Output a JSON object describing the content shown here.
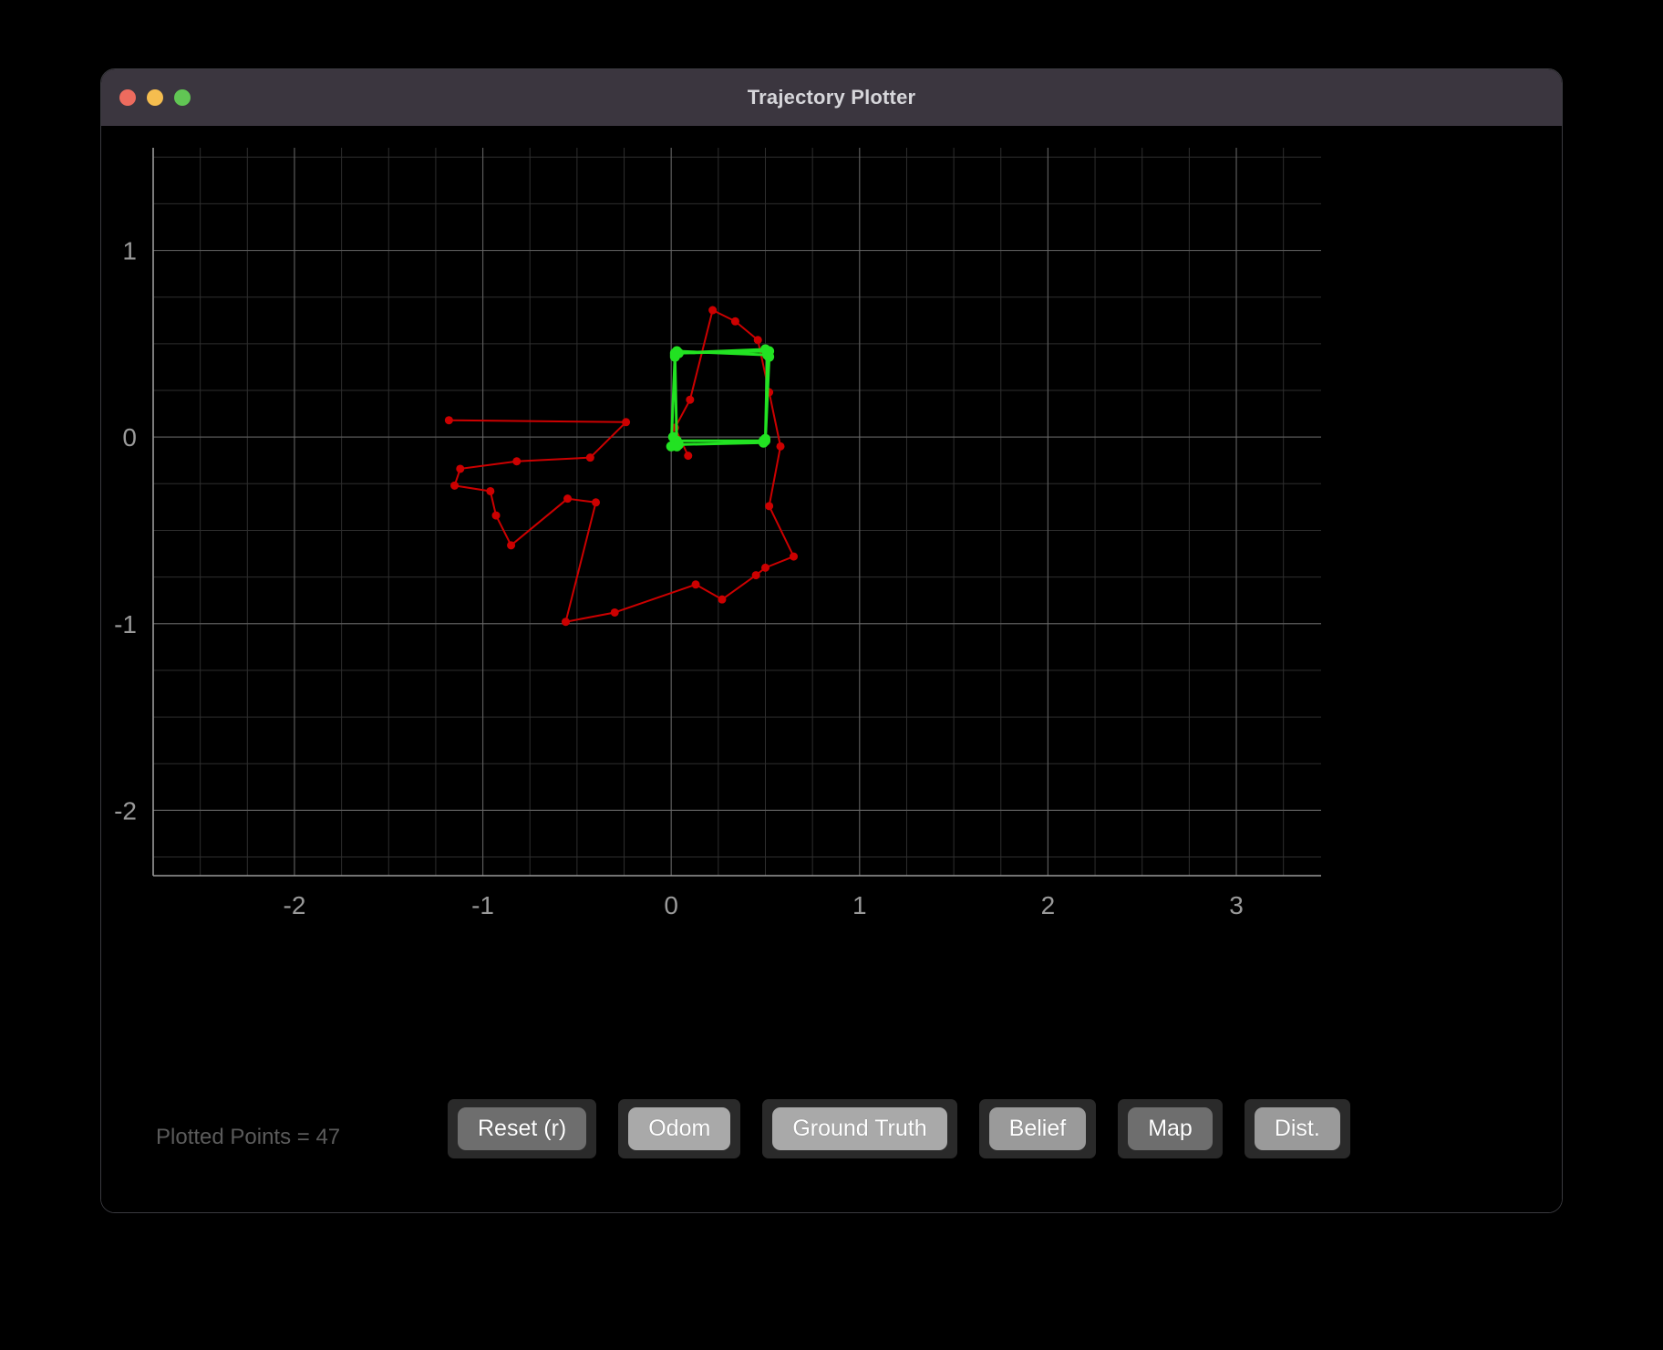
{
  "window": {
    "title": "Trajectory Plotter",
    "traffic_lights": [
      {
        "name": "close",
        "color": "#ED6B5E"
      },
      {
        "name": "minimize",
        "color": "#F5BD4F"
      },
      {
        "name": "zoom",
        "color": "#61C554"
      }
    ]
  },
  "status": {
    "label": "Plotted Points = 47"
  },
  "buttons": [
    {
      "name": "reset",
      "label": "Reset (r)",
      "shade": "shade-dark"
    },
    {
      "name": "odom",
      "label": "Odom",
      "shade": "shade-light"
    },
    {
      "name": "ground-truth",
      "label": "Ground Truth",
      "shade": "shade-light"
    },
    {
      "name": "belief",
      "label": "Belief",
      "shade": "shade-mid"
    },
    {
      "name": "map",
      "label": "Map",
      "shade": "shade-dark"
    },
    {
      "name": "dist",
      "label": "Dist.",
      "shade": "shade-mid"
    }
  ],
  "chart_data": {
    "type": "line",
    "title": "",
    "xlabel": "",
    "ylabel": "",
    "xlim": [
      -2.75,
      3.45
    ],
    "ylim": [
      -2.35,
      1.55
    ],
    "grid": true,
    "background": "#000000",
    "grid_color": "#6b6b6b",
    "minor_grid_color": "#2e2e2e",
    "axis_label_color": "#9a9a9a",
    "legend_position": "none",
    "xticks": [
      -2,
      -1,
      0,
      1,
      2,
      3
    ],
    "xtick_labels": [
      "-2",
      "-1",
      "0",
      "1",
      "2",
      "3"
    ],
    "yticks": [
      1,
      0,
      -1,
      -2
    ],
    "ytick_labels": [
      "1",
      "0",
      "-1",
      "-2"
    ],
    "x_minor_step": 0.25,
    "y_minor_step": 0.25,
    "series": [
      {
        "name": "Odometry",
        "color": "#CC0000",
        "marker": "o",
        "marker_size": 9,
        "line_width": 2,
        "points": [
          [
            -1.18,
            0.09
          ],
          [
            -0.24,
            0.08
          ],
          [
            -0.43,
            -0.11
          ],
          [
            -0.82,
            -0.13
          ],
          [
            -1.12,
            -0.17
          ],
          [
            -1.15,
            -0.26
          ],
          [
            -0.96,
            -0.29
          ],
          [
            -0.93,
            -0.42
          ],
          [
            -0.85,
            -0.58
          ],
          [
            -0.55,
            -0.33
          ],
          [
            -0.4,
            -0.35
          ],
          [
            -0.56,
            -0.99
          ],
          [
            -0.3,
            -0.94
          ],
          [
            0.13,
            -0.79
          ],
          [
            0.27,
            -0.87
          ],
          [
            0.45,
            -0.74
          ],
          [
            0.5,
            -0.7
          ],
          [
            0.65,
            -0.64
          ],
          [
            0.52,
            -0.37
          ],
          [
            0.58,
            -0.05
          ],
          [
            0.52,
            0.24
          ],
          [
            0.46,
            0.52
          ],
          [
            0.34,
            0.62
          ],
          [
            0.22,
            0.68
          ],
          [
            0.1,
            0.2
          ],
          [
            0.02,
            0.05
          ],
          [
            0.09,
            -0.1
          ]
        ]
      },
      {
        "name": "Ground Truth",
        "color": "#22E222",
        "marker": "o",
        "marker_size": 11,
        "line_width": 3,
        "points": [
          [
            0.02,
            0.45
          ],
          [
            0.5,
            0.47
          ],
          [
            0.51,
            0.45
          ],
          [
            0.5,
            -0.01
          ],
          [
            0.49,
            -0.02
          ],
          [
            0.03,
            -0.02
          ],
          [
            0.02,
            -0.03
          ],
          [
            0.01,
            0.0
          ],
          [
            0.0,
            -0.05
          ],
          [
            0.02,
            0.44
          ],
          [
            0.03,
            0.46
          ],
          [
            0.51,
            0.44
          ],
          [
            0.52,
            0.43
          ],
          [
            0.5,
            -0.02
          ],
          [
            0.49,
            -0.03
          ],
          [
            0.04,
            -0.04
          ],
          [
            0.03,
            -0.05
          ],
          [
            0.02,
            0.43
          ],
          [
            0.04,
            0.45
          ],
          [
            0.52,
            0.46
          ]
        ]
      }
    ]
  }
}
